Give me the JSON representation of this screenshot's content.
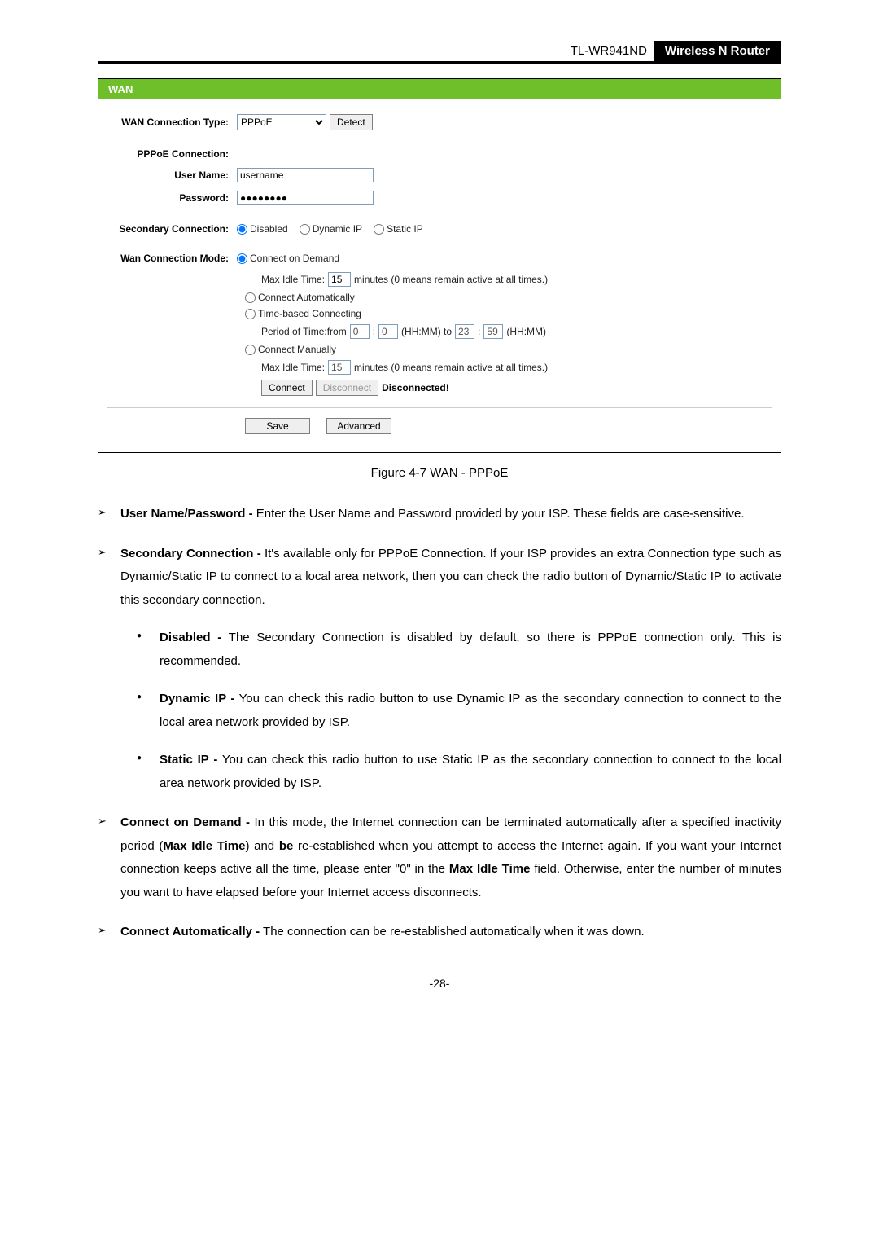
{
  "header": {
    "model": "TL-WR941ND",
    "product": "Wireless  N  Router"
  },
  "wan_title": "WAN",
  "form": {
    "conn_type_label": "WAN Connection Type:",
    "conn_type_value": "PPPoE",
    "detect_btn": "Detect",
    "pppoe_conn_label": "PPPoE Connection:",
    "user_label": "User Name:",
    "user_value": "username",
    "pass_label": "Password:",
    "pass_value": "●●●●●●●●",
    "sec_conn_label": "Secondary Connection:",
    "sec_disabled": "Disabled",
    "sec_dynamic": "Dynamic IP",
    "sec_static": "Static IP",
    "mode_label": "Wan Connection Mode:",
    "mode_demand": "Connect on Demand",
    "idle1_label": "Max Idle Time:",
    "idle1_value": "15",
    "idle1_suffix": "minutes (0 means remain active at all times.)",
    "mode_auto": "Connect Automatically",
    "mode_time": "Time-based Connecting",
    "period_label": "Period of Time:from",
    "period_h1": "0",
    "period_m1": "0",
    "period_mid": "(HH:MM) to",
    "period_h2": "23",
    "period_m2": "59",
    "period_end": "(HH:MM)",
    "mode_manual": "Connect Manually",
    "idle2_value": "15",
    "connect_btn": "Connect",
    "disconnect_btn": "Disconnect",
    "status": "Disconnected!",
    "save_btn": "Save",
    "advanced_btn": "Advanced"
  },
  "figure_caption": "Figure 4-7    WAN - PPPoE",
  "desc": {
    "li1_b": "User Name/Password -",
    "li1_t": " Enter the User Name and Password provided by your ISP. These fields are case-sensitive.",
    "li2_b": "Secondary Connection -",
    "li2_t": " It's available only for PPPoE Connection. If your ISP provides an extra Connection type such as Dynamic/Static IP to connect to a local area network, then you can check the radio button of Dynamic/Static IP to activate this secondary connection.",
    "li2a_b": "Disabled -",
    "li2a_t": " The Secondary Connection is disabled by default, so there is PPPoE connection only. This is recommended.",
    "li2b_b": "Dynamic IP -",
    "li2b_t": " You can check this radio button to use Dynamic IP as the secondary connection to connect to the local area network provided by ISP.",
    "li2c_b": "Static IP -",
    "li2c_t": " You can check this radio button to use Static IP as the secondary connection to connect to the local area network provided by ISP.",
    "li3_b": "Connect on Demand -",
    "li3_t1": " In this mode, the Internet connection can be terminated automatically after a specified inactivity period (",
    "li3_mid1": "Max Idle Time",
    "li3_t2": ") and ",
    "li3_mid2": "be",
    "li3_t3": " re-established when you attempt to access the Internet again. If you want your Internet connection keeps active all the time, please enter \"0\" in the ",
    "li3_mid3": "Max Idle Time",
    "li3_t4": " field. Otherwise, enter the number of minutes you want to have elapsed before your Internet access disconnects.",
    "li4_b": "Connect Automatically -",
    "li4_t": " The connection can be re-established automatically when it was down."
  },
  "page_number": "-28-"
}
